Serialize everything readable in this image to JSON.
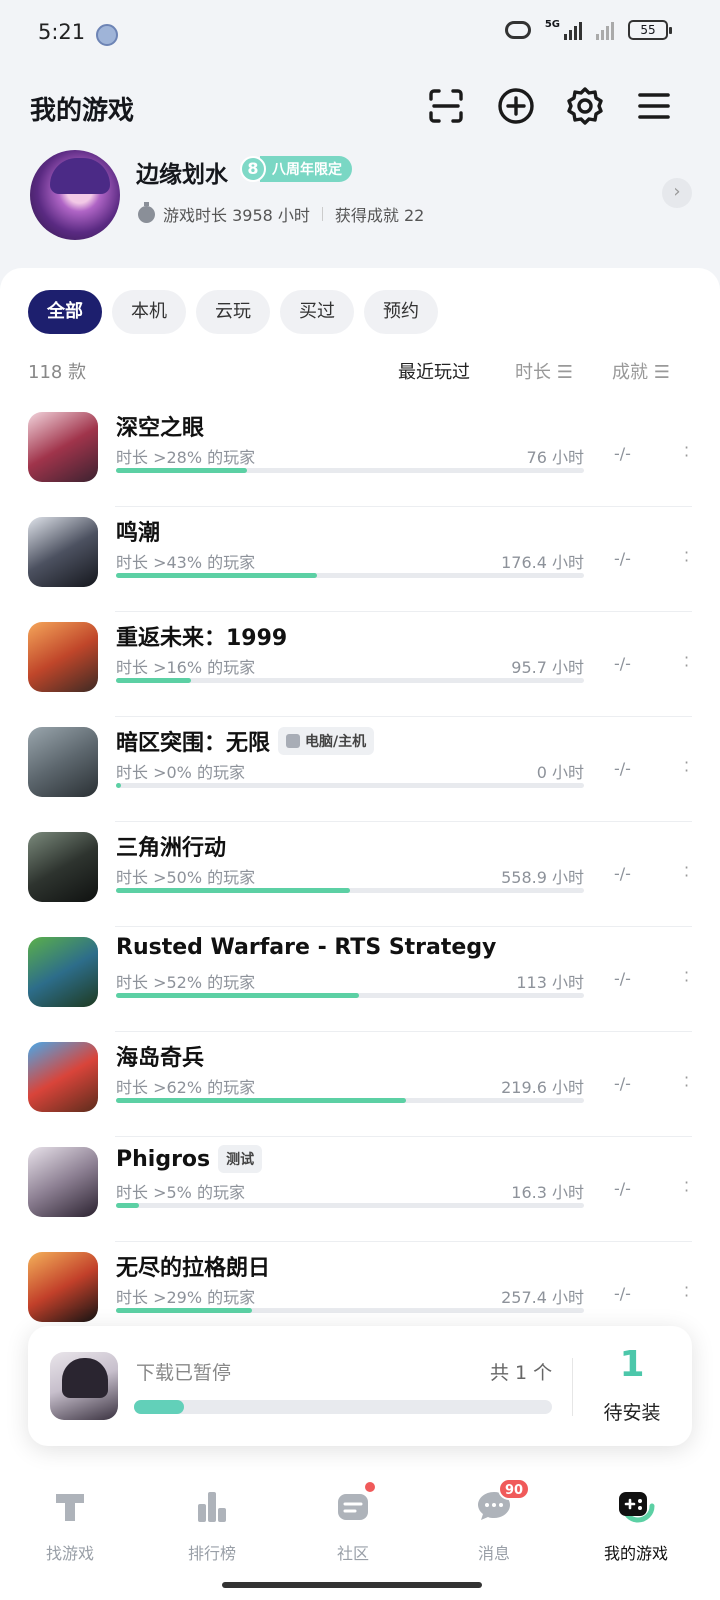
{
  "status_bar": {
    "time": "5:21",
    "network": "5G",
    "battery": "55"
  },
  "header": {
    "title": "我的游戏"
  },
  "profile": {
    "name": "边缘划水",
    "badge_number": "8",
    "badge_text": "八周年限定",
    "playtime": "游戏时长 3958 小时",
    "achievements": "获得成就 22"
  },
  "filters": {
    "all": "全部",
    "local": "本机",
    "cloud": "云玩",
    "bought": "买过",
    "reserved": "预约"
  },
  "sort": {
    "count": "118 款",
    "recent": "最近玩过",
    "duration": "时长 ☰",
    "achievement": "成就 ☰"
  },
  "games": [
    {
      "name": "深空之眼",
      "tag": "",
      "percentile": "时长 >28% 的玩家",
      "hours": "76 小时",
      "achievements": "-/-",
      "progress": 0.28,
      "icon_colors": [
        "#f2d4dc",
        "#a0344b",
        "#3b2230"
      ]
    },
    {
      "name": "鸣潮",
      "tag": "",
      "percentile": "时长 >43% 的玩家",
      "hours": "176.4 小时",
      "achievements": "-/-",
      "progress": 0.43,
      "icon_colors": [
        "#dfe3ea",
        "#4c5160",
        "#15171d"
      ]
    },
    {
      "name": "重返未来：1999",
      "tag": "",
      "percentile": "时长 >16% 的玩家",
      "hours": "95.7 小时",
      "achievements": "-/-",
      "progress": 0.16,
      "icon_colors": [
        "#f5a65a",
        "#c0462a",
        "#3d2a24"
      ]
    },
    {
      "name": "暗区突围：无限",
      "tag": "电脑/主机",
      "percentile": "时长 >0% 的玩家",
      "hours": "0 小时",
      "achievements": "-/-",
      "progress": 0.01,
      "icon_colors": [
        "#9aa6ad",
        "#5d676e",
        "#2a3034"
      ]
    },
    {
      "name": "三角洲行动",
      "tag": "",
      "percentile": "时长 >50% 的玩家",
      "hours": "558.9 小时",
      "achievements": "-/-",
      "progress": 0.5,
      "icon_colors": [
        "#7b8a7c",
        "#2e342f",
        "#0f1110"
      ]
    },
    {
      "name": "Rusted Warfare - RTS Strategy",
      "tag": "",
      "percentile": "时长 >52% 的玩家",
      "hours": "113 小时",
      "achievements": "-/-",
      "progress": 0.52,
      "icon_colors": [
        "#5bb04a",
        "#2d6d8a",
        "#1e3a20"
      ]
    },
    {
      "name": "海岛奇兵",
      "tag": "",
      "percentile": "时长 >62% 的玩家",
      "hours": "219.6 小时",
      "achievements": "-/-",
      "progress": 0.62,
      "icon_colors": [
        "#4aa8e8",
        "#d9443a",
        "#5b2c1c"
      ]
    },
    {
      "name": "Phigros",
      "tag": "测试",
      "percentile": "时长 >5% 的玩家",
      "hours": "16.3 小时",
      "achievements": "-/-",
      "progress": 0.05,
      "icon_colors": [
        "#e8e2ea",
        "#8c7f92",
        "#2b2230"
      ]
    },
    {
      "name": "无尽的拉格朗日",
      "tag": "",
      "percentile": "时长 >29% 的玩家",
      "hours": "257.4 小时",
      "achievements": "-/-",
      "progress": 0.29,
      "icon_colors": [
        "#f4b15a",
        "#c2402a",
        "#141414"
      ]
    }
  ],
  "download": {
    "status": "下载已暂停",
    "total": "共 1 个",
    "progress": 0.12,
    "pending_count": "1",
    "pending_label": "待安装"
  },
  "nav": {
    "find": "找游戏",
    "rank": "排行榜",
    "community": "社区",
    "messages": "消息",
    "mine": "我的游戏",
    "messages_badge": "90"
  },
  "colors": {
    "accent": "#5cd0a4",
    "chip_active": "#1d1f6e",
    "badge_red": "#f05a5a"
  }
}
